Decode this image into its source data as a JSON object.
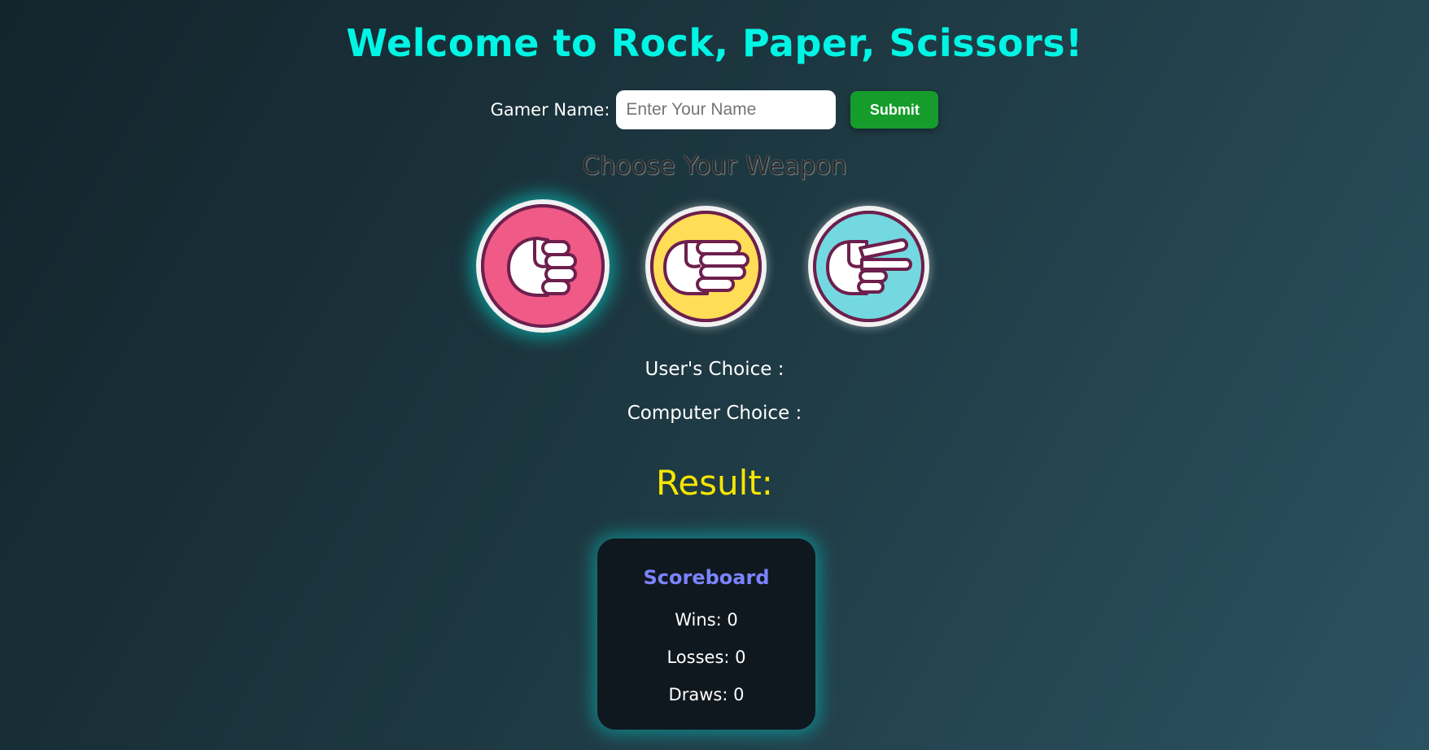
{
  "header": {
    "title": "Welcome to Rock, Paper, Scissors!"
  },
  "name_form": {
    "label": "Gamer Name:",
    "input_value": "",
    "input_placeholder": "Enter Your Name",
    "submit_label": "Submit"
  },
  "weapons": {
    "heading": "Choose Your Weapon",
    "items": [
      {
        "icon": "rock-fist-icon",
        "color": "#ef5a86",
        "active": true
      },
      {
        "icon": "paper-hand-icon",
        "color": "#ffdd57",
        "active": false
      },
      {
        "icon": "scissors-hand-icon",
        "color": "#74d8e0",
        "active": false
      }
    ]
  },
  "choices": {
    "user_label": "User's Choice :",
    "computer_label": "Computer Choice :"
  },
  "result": {
    "label": "Result:"
  },
  "scoreboard": {
    "title": "Scoreboard",
    "wins": "Wins: 0",
    "losses": "Losses: 0",
    "draws": "Draws: 0"
  },
  "colors": {
    "title": "#00f5e4",
    "submit": "#169c2b",
    "result": "#f7e600",
    "scoreboard_title": "#7b84ff",
    "icon_outline": "#6d1f4d"
  }
}
